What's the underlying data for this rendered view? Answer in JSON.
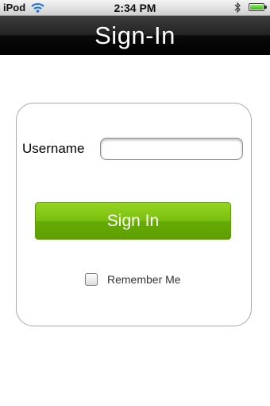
{
  "status_bar": {
    "carrier": "iPod",
    "time": "2:34 PM",
    "icons": [
      "wifi-icon",
      "bluetooth-icon",
      "battery-icon"
    ]
  },
  "header": {
    "title": "Sign-In"
  },
  "form": {
    "username_label": "Username",
    "username_value": "",
    "signin_label": "Sign In",
    "remember_label": "Remember Me",
    "remember_checked": false
  },
  "colors": {
    "title_bar": "#1a1a1a",
    "signin_button": "#7bbf0f",
    "card_border": "#a9a9a9"
  }
}
